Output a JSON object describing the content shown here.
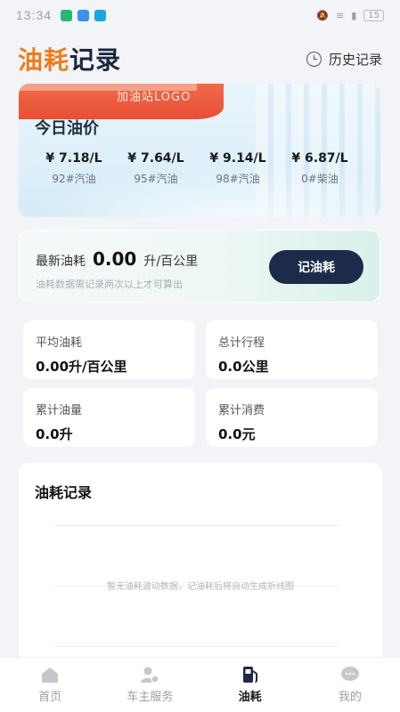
{
  "status_bar": {
    "time": "13:34",
    "battery": "15"
  },
  "header": {
    "title_accent": "油耗",
    "title_main": "记录",
    "history_label": "历史记录"
  },
  "price_card": {
    "logo_text": "加油站LOGO",
    "label": "今日油价",
    "prices": [
      {
        "value": "¥ 7.18/L",
        "name": "92#汽油"
      },
      {
        "value": "¥ 7.64/L",
        "name": "95#汽油"
      },
      {
        "value": "¥ 9.14/L",
        "name": "98#汽油"
      },
      {
        "value": "¥ 6.87/L",
        "name": "0#柴油"
      }
    ]
  },
  "latest": {
    "label": "最新油耗",
    "value": "0.00",
    "unit": "升/百公里",
    "hint": "油耗数据需记录两次以上才可算出",
    "button": "记油耗"
  },
  "stats": [
    {
      "label": "平均油耗",
      "value": "0.00升/百公里"
    },
    {
      "label": "总计行程",
      "value": "0.0公里"
    },
    {
      "label": "累计油量",
      "value": "0.0升"
    },
    {
      "label": "累计消费",
      "value": "0.0元"
    }
  ],
  "records": {
    "title": "油耗记录",
    "empty": "暂无油耗波动数据，记油耗后将自动生成折线图"
  },
  "tabbar": [
    {
      "label": "首页",
      "icon": "home-icon",
      "active": false
    },
    {
      "label": "车主服务",
      "icon": "owner-service-icon",
      "active": false
    },
    {
      "label": "油耗",
      "icon": "fuel-pump-icon",
      "active": true
    },
    {
      "label": "我的",
      "icon": "chat-icon",
      "active": false
    }
  ],
  "colors": {
    "accent": "#f07b1d",
    "navy": "#1e2a4a",
    "background": "#f2f4f7"
  }
}
